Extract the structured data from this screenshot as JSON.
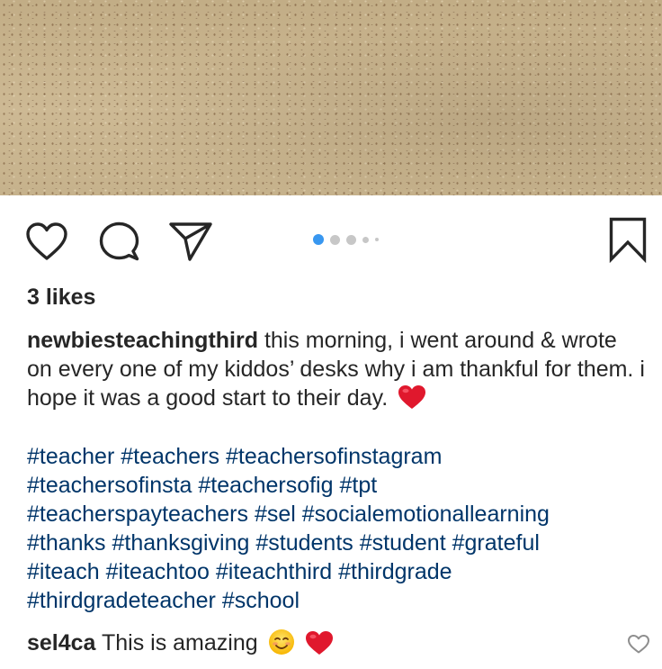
{
  "post": {
    "image_alt": "desk surface photo",
    "carousel": {
      "total_dots": 5,
      "active_index": 0
    },
    "actions": {
      "like_icon": "heart-outline-icon",
      "comment_icon": "speech-bubble-icon",
      "share_icon": "paper-plane-icon",
      "save_icon": "bookmark-icon"
    },
    "likes_text": "3 likes",
    "caption": {
      "username": "newbiesteachingthird",
      "text": "this morning, i went around & wrote on every one of my kiddos’ desks why i am thankful for them. i hope it was a good start to their day.",
      "emoji": "red-heart-emoji"
    },
    "hashtags": [
      "#teacher",
      "#teachers",
      "#teachersofinstagram",
      "#teachersofinsta",
      "#teachersofig",
      "#tpt",
      "#teacherspayteachers",
      "#sel",
      "#socialemotionallearning",
      "#thanks",
      "#thanksgiving",
      "#students",
      "#student",
      "#grateful",
      "#iteach",
      "#iteachtoo",
      "#iteachthird",
      "#thirdgrade",
      "#thirdgradeteacher",
      "#school"
    ],
    "comment": {
      "username": "sel4ca",
      "text": "This is amazing",
      "emojis": [
        "smiling-face-emoji",
        "red-heart-emoji"
      ]
    },
    "colors": {
      "hashtag": "#003569",
      "text": "#262626",
      "active_dot": "#3897f0",
      "inactive_dot": "#c7c7c7"
    }
  }
}
